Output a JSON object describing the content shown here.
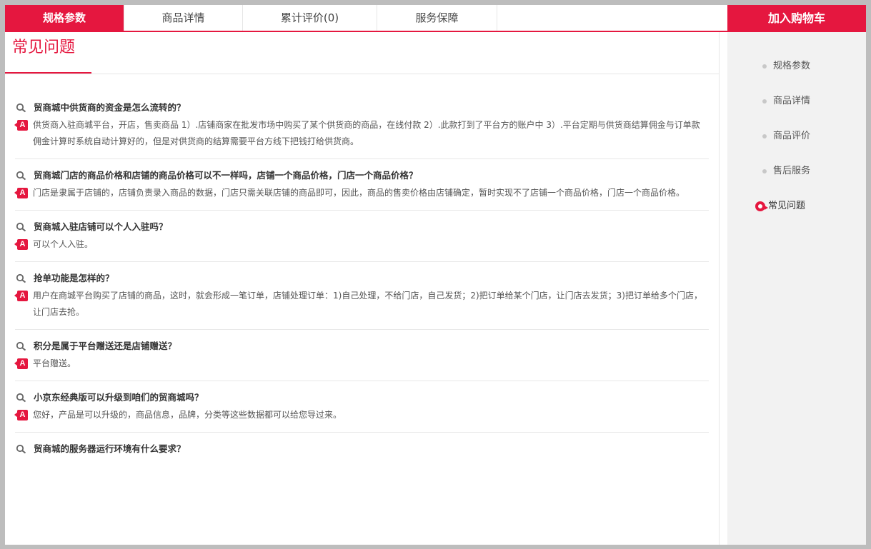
{
  "tabs": [
    {
      "label": "规格参数",
      "active": true
    },
    {
      "label": "商品详情",
      "active": false
    },
    {
      "label": "累计评价(0)",
      "active": false
    },
    {
      "label": "服务保障",
      "active": false
    }
  ],
  "cart_button": "加入购物车",
  "section_title": "常见问题",
  "faq": [
    {
      "q": "贸商城中供货商的资金是怎么流转的？",
      "a": "供货商入驻商城平台，开店，售卖商品 1）.店铺商家在批发市场中购买了某个供货商的商品，在线付款 2）.此款打到了平台方的账户中 3）.平台定期与供货商结算佣金与订单款 佣金计算时系统自动计算好的，但是对供货商的结算需要平台方线下把钱打给供货商。"
    },
    {
      "q": "贸商城门店的商品价格和店铺的商品价格可以不一样吗，店铺一个商品价格，门店一个商品价格？",
      "a": "门店是隶属于店铺的，店铺负责录入商品的数据，门店只需关联店铺的商品即可，因此，商品的售卖价格由店铺确定，暂时实现不了店铺一个商品价格，门店一个商品价格。"
    },
    {
      "q": "贸商城入驻店铺可以个人入驻吗？",
      "a": "可以个人入驻。"
    },
    {
      "q": "抢单功能是怎样的？",
      "a": "用户在商城平台购买了店铺的商品，这时，就会形成一笔订单，店铺处理订单：1)自己处理，不给门店，自己发货；2)把订单给某个门店，让门店去发货；3)把订单给多个门店，让门店去抢。"
    },
    {
      "q": "积分是属于平台赠送还是店铺赠送？",
      "a": "平台赠送。"
    },
    {
      "q": "小京东经典版可以升级到咱们的贸商城吗？",
      "a": "您好，产品是可以升级的，商品信息，品牌，分类等这些数据都可以给您导过来。"
    },
    {
      "q": "贸商城的服务器运行环境有什么要求？",
      "a": ""
    }
  ],
  "side_nav": [
    {
      "label": "规格参数",
      "active": false
    },
    {
      "label": "商品详情",
      "active": false
    },
    {
      "label": "商品评价",
      "active": false
    },
    {
      "label": "售后服务",
      "active": false
    },
    {
      "label": "常见问题",
      "active": true
    }
  ],
  "colors": {
    "accent": "#e5173f",
    "side_bg": "#f2f2f2"
  }
}
